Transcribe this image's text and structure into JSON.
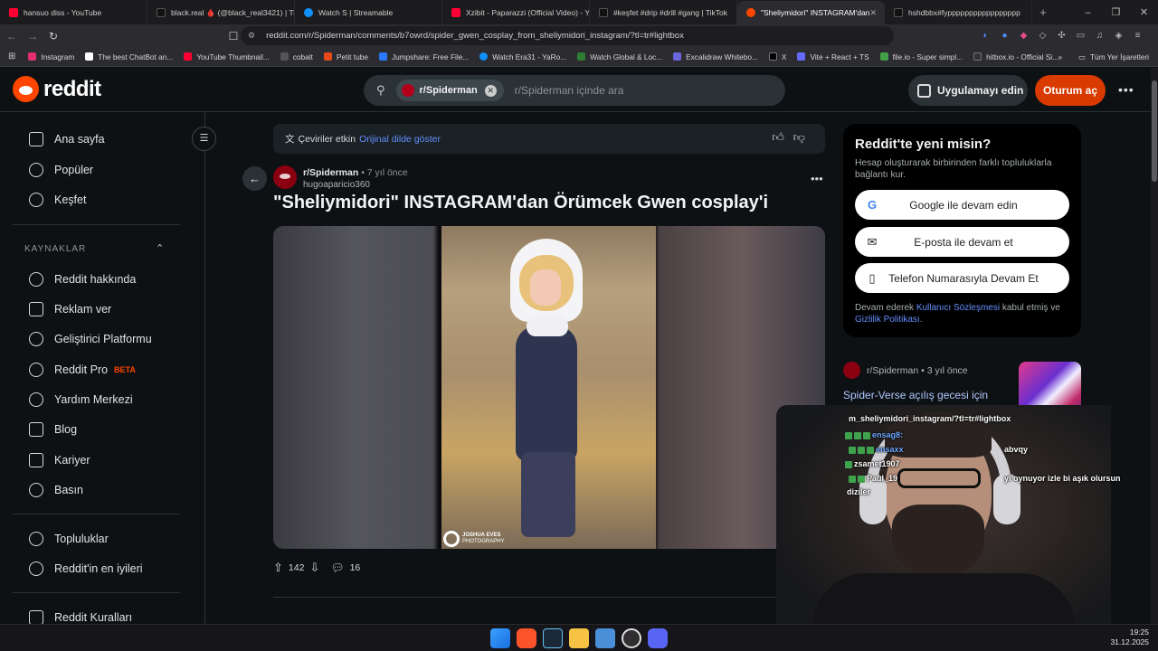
{
  "browser": {
    "tabs": [
      {
        "label": "hansuo diss - YouTube",
        "color": "#ff0033"
      },
      {
        "label": "black.real 🩸 (@black_real3421) | Tik",
        "color": "#111111"
      },
      {
        "label": "Watch S | Streamable",
        "color": "#0f90fa"
      },
      {
        "label": "Xzibit - Paparazzi (Official Video) - Yo",
        "color": "#ff0033"
      },
      {
        "label": "#keşfet #drip #drill #gang | TikTok",
        "color": "#111111"
      },
      {
        "label": "\"Sheliymidori\" INSTAGRAM'dan",
        "color": "#ff4500",
        "active": true
      },
      {
        "label": "hshdbbx#fyppppppppppppppppp",
        "color": "#111111"
      }
    ],
    "new_tab": "+",
    "url": "reddit.com/r/Spiderman/comments/b7owrd/spider_gwen_cosplay_from_sheliymidori_instagram/?tl=tr#lightbox",
    "bookmarks": [
      {
        "label": "Instagram",
        "color": "#e1306c"
      },
      {
        "label": "The best ChatBot an...",
        "color": "#ffffff"
      },
      {
        "label": "YouTube Thumbnail...",
        "color": "#ff0033"
      },
      {
        "label": "cobalt",
        "color": "#444444"
      },
      {
        "label": "Petit tube",
        "color": "#e64a19"
      },
      {
        "label": "Jumpshare: Free File...",
        "color": "#2979ff"
      },
      {
        "label": "Watch Era31 - YaRo...",
        "color": "#0f90fa"
      },
      {
        "label": "Watch Global & Loc...",
        "color": "#2e7d32"
      },
      {
        "label": "Excalidraw Whitebo...",
        "color": "#6965db"
      },
      {
        "label": "X",
        "color": "#000000"
      },
      {
        "label": "Vite + React + TS",
        "color": "#646cff"
      },
      {
        "label": "file.io - Super simpl...",
        "color": "#43a047"
      },
      {
        "label": "hitbox.io - Official Si...",
        "color": "#333333"
      }
    ],
    "bookmarks_overflow": "»",
    "all_bookmarks": "Tüm Yer İşaretleri",
    "window_controls": [
      "–",
      "❐",
      "✕"
    ]
  },
  "header": {
    "logo_text": "reddit",
    "search_chip": "r/Spiderman",
    "search_placeholder": "r/Spiderman içinde ara",
    "get_app": "Uygulamayı edin",
    "login": "Oturum aç",
    "more": "•••"
  },
  "leftnav": {
    "main": [
      {
        "label": "Ana sayfa",
        "icon": "home-icon"
      },
      {
        "label": "Popüler",
        "icon": "popular-icon"
      },
      {
        "label": "Keşfet",
        "icon": "explore-icon"
      }
    ],
    "resources_header": "KAYNAKLAR",
    "resources": [
      {
        "label": "Reddit hakkında",
        "icon": "reddit-alien-icon"
      },
      {
        "label": "Reklam ver",
        "icon": "megaphone-icon"
      },
      {
        "label": "Geliştirici Platformu",
        "icon": "developer-icon"
      },
      {
        "label": "Reddit Pro",
        "icon": "pro-icon",
        "badge": "BETA"
      },
      {
        "label": "Yardım Merkezi",
        "icon": "help-icon"
      },
      {
        "label": "Blog",
        "icon": "blog-icon"
      },
      {
        "label": "Kariyer",
        "icon": "briefcase-icon"
      },
      {
        "label": "Basın",
        "icon": "press-icon"
      }
    ],
    "more": [
      {
        "label": "Topluluklar",
        "icon": "communities-icon"
      },
      {
        "label": "Reddit'in en iyileri",
        "icon": "best-of-icon"
      }
    ],
    "bottom": [
      {
        "label": "Reddit Kuralları",
        "icon": "rules-icon"
      }
    ]
  },
  "post": {
    "translate_text": "Çeviriler etkin",
    "translate_link": "Orijinal dilde göster",
    "subreddit": "r/Spiderman",
    "age": "• 7 yıl önce",
    "author": "hugoaparicio360",
    "title": "\"Sheliymidori\" INSTAGRAM'dan Örümcek Gwen cosplay'i",
    "watermark_line1": "JOSHUA EVES",
    "watermark_line2": "PHOTOGRAPHY",
    "votes": "142",
    "comments": "16"
  },
  "signup": {
    "title": "Reddit'te yeni misin?",
    "desc": "Hesap oluşturarak birbirinden farklı topluluklarla bağlantı kur.",
    "google": "Google ile devam edin",
    "email": "E-posta ile devam et",
    "phone": "Telefon Numarasıyla Devam Et",
    "terms_prefix": "Devam ederek ",
    "terms_link1": "Kullanıcı Sözleşmesi",
    "terms_mid": " kabul etmiş ve ",
    "terms_link2": "Gizlilik Politikası",
    "terms_suffix": "."
  },
  "related": {
    "sub": "r/Spiderman • 3 yıl önce",
    "title": "Spider-Verse açılış gecesi için Gwen Stacy / Spider Gwen...",
    "thumb_count": "2"
  },
  "stream_chat": [
    "m_sheliymidori_instagram/?tl=tr#lightbox",
    "ensag8:",
    "ensaxx",
    "zsamet1907",
    "Paul_19",
    "diziler",
    "abvqy",
    "yi oynuyor izle bi aşık olursun"
  ],
  "taskbar": {
    "time": "19:25",
    "date": "31.12.2025"
  }
}
